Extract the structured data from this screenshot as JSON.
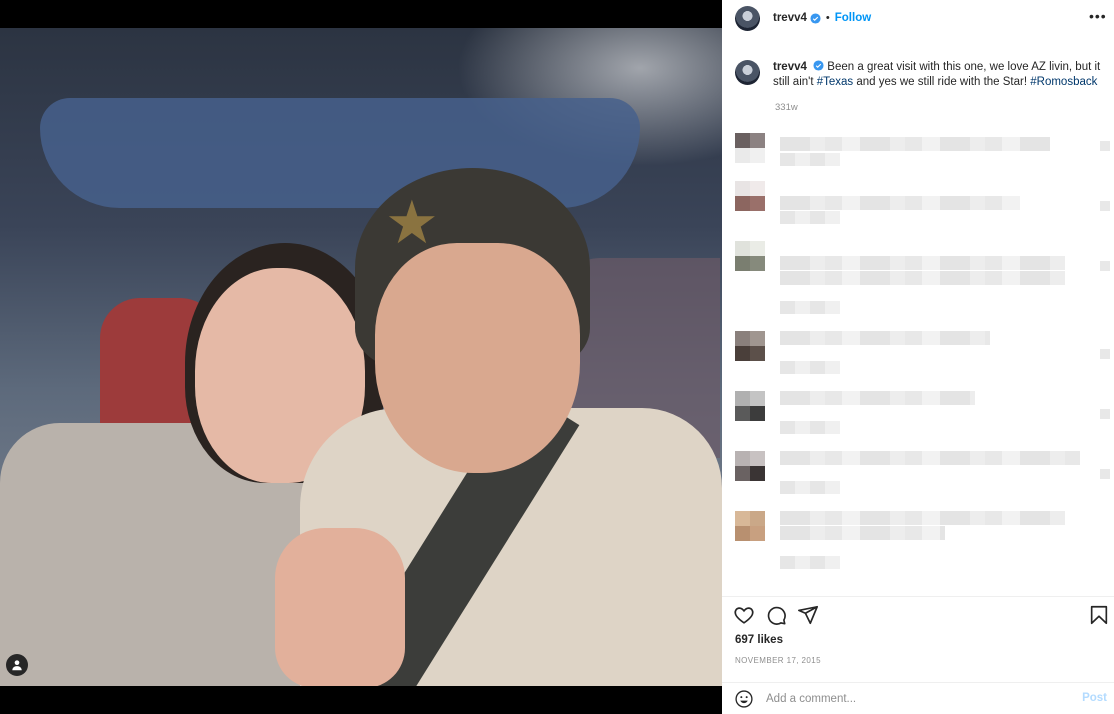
{
  "post": {
    "username": "trevv4",
    "follow_label": "Follow",
    "separator": "•",
    "more_label": "•••",
    "caption": {
      "text_before": "Been a great visit with this one, we love AZ livin, but it still ain't ",
      "hashtag1": "#Texas",
      "text_middle": " and yes we still ride with the Star! ",
      "hashtag2": "#Romosback"
    },
    "caption_time": "331w",
    "likes": "697 likes",
    "date": "NOVEMBER 17, 2015",
    "comment_placeholder": "Add a comment...",
    "post_label": "Post"
  },
  "icons": {
    "verified": "verified-badge-icon",
    "like": "heart-icon",
    "comment": "comment-icon",
    "share": "share-icon",
    "save": "bookmark-icon",
    "emoji": "emoji-icon",
    "user_tag": "user-tag-icon",
    "more": "more-options-icon"
  },
  "colors": {
    "accent": "#0095f6",
    "hashtag": "#00376b",
    "muted": "#8e8e8e"
  }
}
